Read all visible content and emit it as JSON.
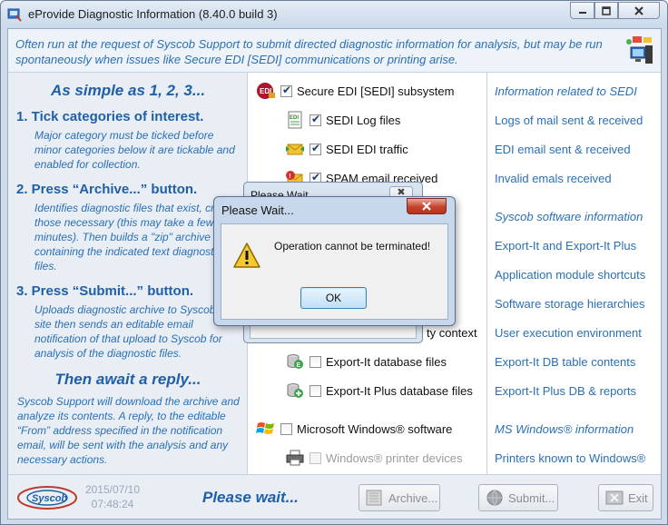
{
  "window": {
    "title": "eProvide Diagnostic Information (8.40.0 build 3)"
  },
  "banner": {
    "text": "Often run at the request of Syscob Support to submit directed diagnostic information for analysis, but may be run spontaneously when issues like Secure EDI [SEDI] communications or printing arise."
  },
  "left": {
    "heading": "As simple as 1, 2, 3...",
    "steps": [
      {
        "title": "1. Tick categories of interest.",
        "desc": "Major category must be ticked before minor categories below it are tickable and enabled for collection."
      },
      {
        "title": "2. Press “Archive...” button.",
        "desc": "Identifies diagnostic files that exist, creates those necessary (this may take a few minutes).  Then builds a \"zip\" archive containing the indicated text diagnostic files."
      },
      {
        "title": "3. Press “Submit...” button.",
        "desc": "Uploads diagnostic archive to Syscob FTP site then sends an editable email notification of that upload to Syscob for analysis of the diagnostic files."
      }
    ],
    "await_heading": "Then await a reply...",
    "await_text": "Syscob Support will download the archive and analyze its contents.  A reply, to the editable “From” address specified in the notification email, will be sent with the analysis and any necessary actions."
  },
  "categories": [
    {
      "label": "Secure EDI [SEDI] subsystem",
      "checked": true,
      "enabled": true,
      "icon": "sedi-icon",
      "link": "Information related to SEDI",
      "link_header": true
    },
    {
      "label": "SEDI Log files",
      "checked": true,
      "enabled": true,
      "icon": "edi-log-icon",
      "link": "Logs of mail sent & received",
      "link_header": false
    },
    {
      "label": "SEDI EDI traffic",
      "checked": true,
      "enabled": true,
      "icon": "mail-traffic-icon",
      "link": "EDI email sent & received",
      "link_header": false
    },
    {
      "label": "SPAM email received",
      "checked": true,
      "enabled": true,
      "icon": "spam-mail-icon",
      "link": "Invalid emals received",
      "link_header": false
    },
    {
      "label": "",
      "checked": false,
      "enabled": true,
      "icon": "",
      "link": "Syscob software information",
      "link_header": true
    },
    {
      "label": "",
      "checked": false,
      "enabled": true,
      "icon": "",
      "link": "Export-It and Export-It Plus",
      "link_header": false
    },
    {
      "label": "",
      "checked": false,
      "enabled": true,
      "icon": "",
      "link": "Application module shortcuts",
      "link_header": false
    },
    {
      "label": "",
      "checked": false,
      "enabled": true,
      "icon": "",
      "link": "Software storage hierarchies",
      "link_header": false
    },
    {
      "label": "ty context",
      "checked": false,
      "enabled": true,
      "icon": "",
      "link": "User execution environment",
      "link_header": false
    },
    {
      "label": "Export-It database files",
      "checked": false,
      "enabled": true,
      "icon": "database-icon",
      "link": "Export-It DB table contents",
      "link_header": false
    },
    {
      "label": "Export-It Plus database files",
      "checked": false,
      "enabled": true,
      "icon": "database-plus-icon",
      "link": "Export-It Plus DB & reports",
      "link_header": false
    },
    {
      "label": "Microsoft Windows® software",
      "checked": false,
      "enabled": true,
      "icon": "windows-logo-icon",
      "link": "MS Windows® information",
      "link_header": true
    },
    {
      "label": "Windows® printer devices",
      "checked": false,
      "enabled": false,
      "icon": "printer-icon",
      "link": "Printers known to Windows®",
      "link_header": false
    }
  ],
  "bottom": {
    "logo_text": "Syscob",
    "date": "2015/07/10",
    "time": "07:48:24",
    "status": "Please wait...",
    "archive_label": "Archive...",
    "submit_label": "Submit...",
    "exit_label": "Exit"
  },
  "back_dialog": {
    "title": "Please Wait...",
    "close": "✖"
  },
  "modal": {
    "title": "Please Wait...",
    "message": "Operation cannot be terminated!",
    "ok_label": "OK"
  }
}
